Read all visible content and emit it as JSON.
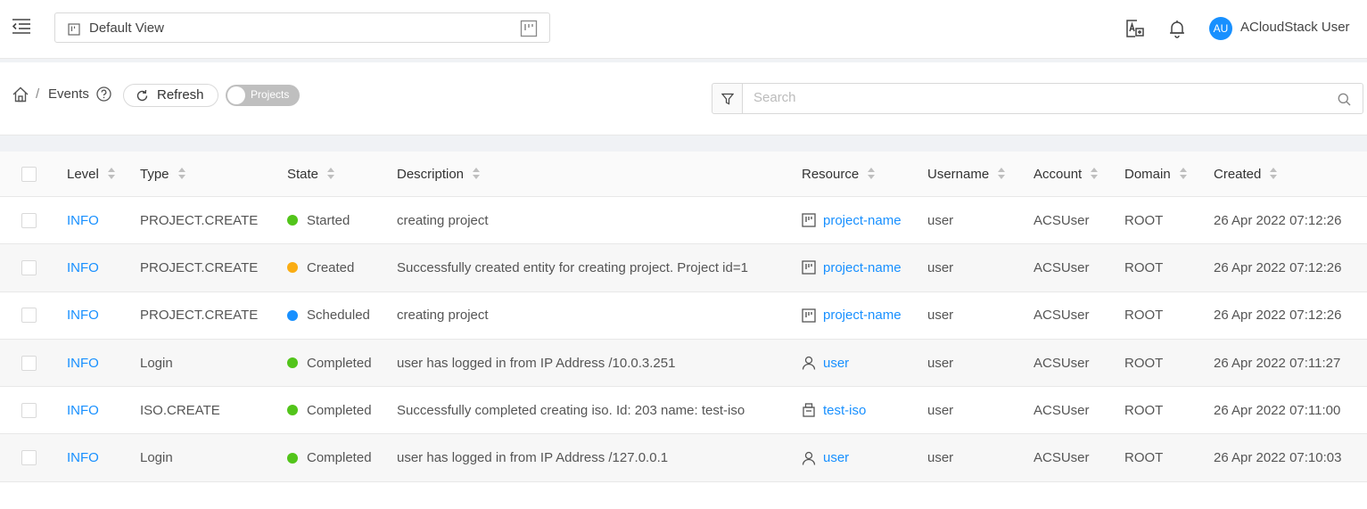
{
  "header": {
    "project_name": "Default View",
    "user_initials": "AU",
    "user_name": "ACloudStack User"
  },
  "breadcrumb": {
    "current": "Events"
  },
  "toolbar": {
    "refresh_label": "Refresh",
    "toggle_label": "Projects",
    "search_placeholder": "Search"
  },
  "table": {
    "columns": [
      "Level",
      "Type",
      "State",
      "Description",
      "Resource",
      "Username",
      "Account",
      "Domain",
      "Created"
    ],
    "rows": [
      {
        "level": "INFO",
        "type": "PROJECT.CREATE",
        "state": "Started",
        "state_color": "#52c41a",
        "description": "creating project",
        "resource": "project-name",
        "resource_icon": "project-icon",
        "username": "user",
        "account": "ACSUser",
        "domain": "ROOT",
        "created": "26 Apr 2022 07:12:26"
      },
      {
        "level": "INFO",
        "type": "PROJECT.CREATE",
        "state": "Created",
        "state_color": "#faad14",
        "description": "Successfully created entity for creating project. Project id=1",
        "resource": "project-name",
        "resource_icon": "project-icon",
        "username": "user",
        "account": "ACSUser",
        "domain": "ROOT",
        "created": "26 Apr 2022 07:12:26"
      },
      {
        "level": "INFO",
        "type": "PROJECT.CREATE",
        "state": "Scheduled",
        "state_color": "#1890ff",
        "description": "creating project",
        "resource": "project-name",
        "resource_icon": "project-icon",
        "username": "user",
        "account": "ACSUser",
        "domain": "ROOT",
        "created": "26 Apr 2022 07:12:26"
      },
      {
        "level": "INFO",
        "type": "Login",
        "state": "Completed",
        "state_color": "#52c41a",
        "description": "user has logged in from IP Address /10.0.3.251",
        "resource": "user",
        "resource_icon": "user-icon",
        "username": "user",
        "account": "ACSUser",
        "domain": "ROOT",
        "created": "26 Apr 2022 07:11:27"
      },
      {
        "level": "INFO",
        "type": "ISO.CREATE",
        "state": "Completed",
        "state_color": "#52c41a",
        "description": "Successfully completed creating iso. Id: 203 name: test-iso",
        "resource": "test-iso",
        "resource_icon": "iso-icon",
        "username": "user",
        "account": "ACSUser",
        "domain": "ROOT",
        "created": "26 Apr 2022 07:11:00"
      },
      {
        "level": "INFO",
        "type": "Login",
        "state": "Completed",
        "state_color": "#52c41a",
        "description": "user has logged in from IP Address /127.0.0.1",
        "resource": "user",
        "resource_icon": "user-icon",
        "username": "user",
        "account": "ACSUser",
        "domain": "ROOT",
        "created": "26 Apr 2022 07:10:03"
      }
    ]
  },
  "colors": {
    "accent": "#1890ff",
    "link": "#1890ff",
    "toggle_off": "#bfbfbf"
  }
}
